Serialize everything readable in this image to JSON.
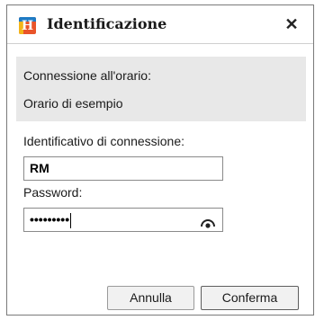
{
  "dialog": {
    "title": "Identificazione",
    "close_glyph": "✕",
    "app_icon_letter": "H",
    "app_icon_name": "app-logo-icon"
  },
  "info": {
    "line1": "Connessione all'orario:",
    "line2": "Orario di esempio"
  },
  "form": {
    "username_label": "Identificativo di connessione:",
    "username_value": "RM",
    "password_label": "Password:",
    "password_mask": "•••••••••",
    "eye_icon": "show-password-icon"
  },
  "buttons": {
    "cancel_label": "Annulla",
    "confirm_label": "Conferma"
  },
  "colors": {
    "panel_bg": "#e8e8e8",
    "border": "#7a7a7a",
    "icon_orange": "#e9542a",
    "icon_blue": "#1e7bc4",
    "icon_yellow": "#f3b51a"
  }
}
